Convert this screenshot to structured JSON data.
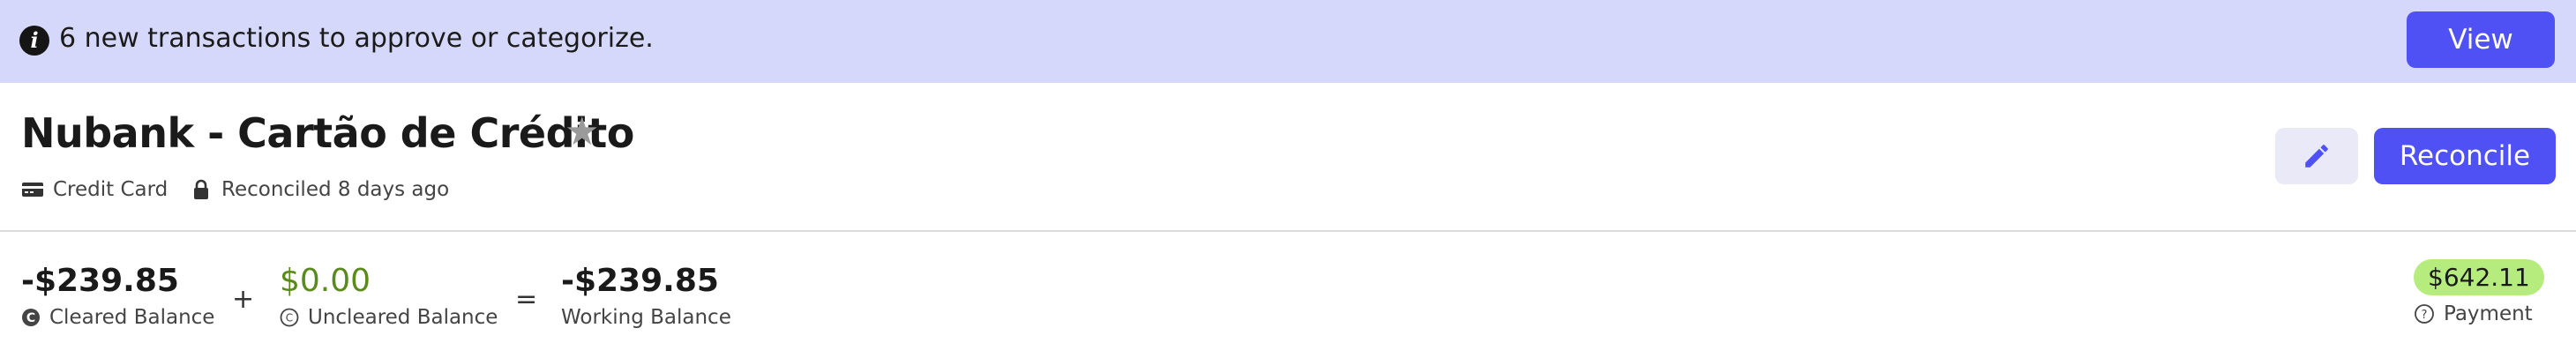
{
  "banner": {
    "icon": "info-icon",
    "message": "6 new transactions to approve or categorize.",
    "view_label": "View",
    "bg_color": "#d6d8fb",
    "accent_color": "#4f51f5"
  },
  "account": {
    "name": "Nubank - Cartão de Crédito",
    "favorite_icon": "star-icon",
    "type_label": "Credit Card",
    "reconciled_label": "Reconciled 8 days ago"
  },
  "actions": {
    "edit_icon": "pencil-icon",
    "reconcile_label": "Reconcile"
  },
  "balances": {
    "cleared": {
      "amount": "-$239.85",
      "label": "Cleared Balance",
      "icon": "cleared-c-icon"
    },
    "plus": "+",
    "uncleared": {
      "amount": "$0.00",
      "label": "Uncleared Balance",
      "icon": "uncleared-c-icon",
      "color": "#5a8a1a"
    },
    "equals": "=",
    "working": {
      "amount": "-$239.85",
      "label": "Working Balance"
    }
  },
  "payment": {
    "amount": "$642.11",
    "label": "Payment",
    "icon": "help-circle-icon",
    "badge_color": "#b6ec7e"
  }
}
